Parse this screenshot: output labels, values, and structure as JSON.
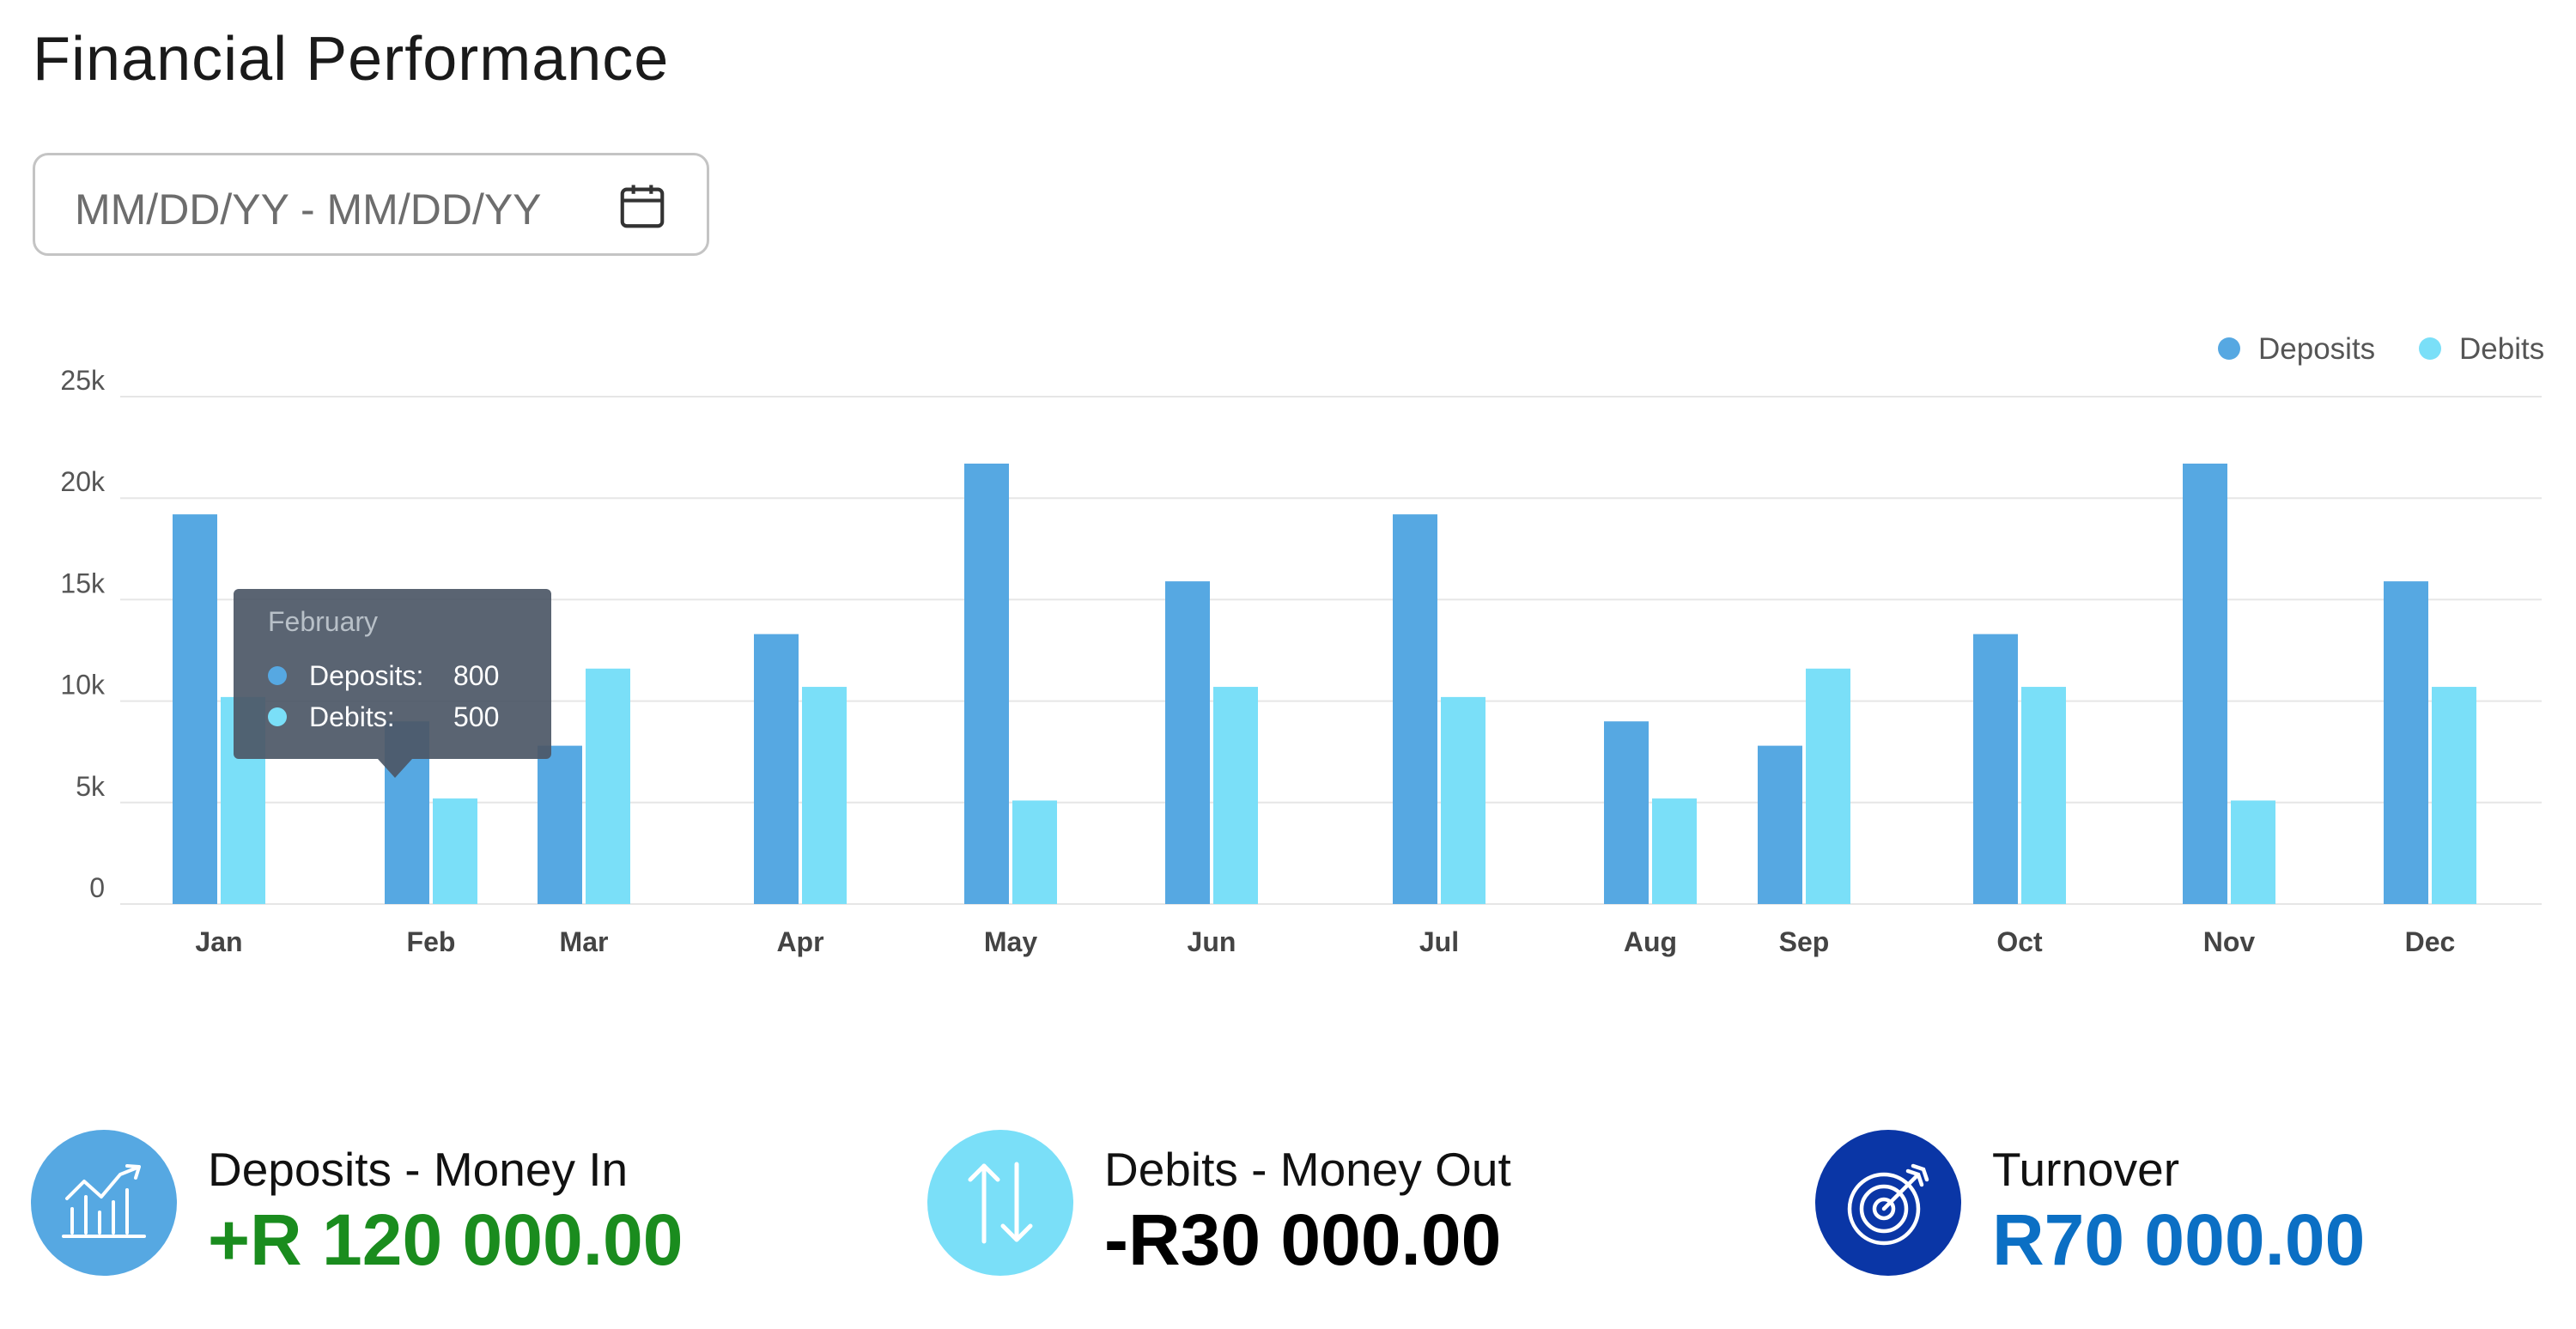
{
  "title": "Financial Performance",
  "date_range": {
    "placeholder": "MM/DD/YY - MM/DD/YY",
    "icon": "calendar-icon"
  },
  "colors": {
    "deposits": "#56a8e2",
    "debits": "#7adff8",
    "positive": "#1a8c1e",
    "negative": "#000000",
    "turnover": "#0b6fc4",
    "turnover_circle": "#0a36a6"
  },
  "tooltip": {
    "title": "February",
    "rows": [
      {
        "label": "Deposits:",
        "value": "800"
      },
      {
        "label": "Debits:",
        "value": "500"
      }
    ]
  },
  "chart_data": {
    "type": "bar",
    "categories": [
      "Jan",
      "Feb",
      "Mar",
      "Apr",
      "May",
      "Jun",
      "Jul",
      "Aug",
      "Sep",
      "Oct",
      "Nov",
      "Dec"
    ],
    "series": [
      {
        "name": "Deposits",
        "values": [
          19200,
          9000,
          7800,
          13300,
          21700,
          15900,
          19200,
          9000,
          7800,
          13300,
          21700,
          15900
        ]
      },
      {
        "name": "Debits",
        "values": [
          10200,
          5200,
          11600,
          10700,
          5100,
          10700,
          10200,
          5200,
          11600,
          10700,
          5100,
          10700
        ]
      }
    ],
    "y_ticks": [
      "0",
      "5k",
      "10k",
      "15k",
      "20k",
      "25k"
    ],
    "ylim": [
      0,
      25000
    ],
    "grid": true,
    "legend_position": "top-right"
  },
  "stats": [
    {
      "label": "Deposits - Money In",
      "value": "+R 120 000.00",
      "icon": "chart-up-icon"
    },
    {
      "label": "Debits - Money Out",
      "value": "-R30 000.00",
      "icon": "arrows-up-down-icon"
    },
    {
      "label": "Turnover",
      "value": "R70 000.00",
      "icon": "target-icon"
    }
  ]
}
